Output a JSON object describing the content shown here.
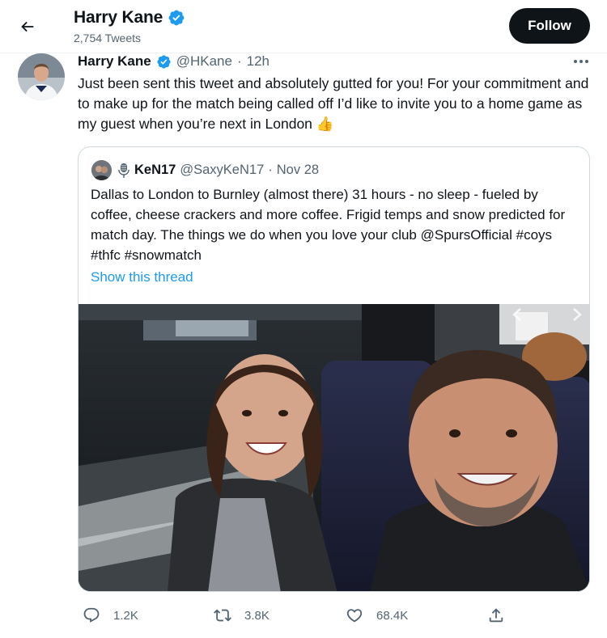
{
  "header": {
    "name": "Harry Kane",
    "tweet_count": "2,754 Tweets",
    "follow_label": "Follow",
    "verified_icon": "verified-badge-icon",
    "back_icon": "arrow-left-icon"
  },
  "tweet": {
    "author": "Harry Kane",
    "handle": "@HKane",
    "separator": "·",
    "time": "12h",
    "text": "Just been sent this tweet and absolutely gutted for you! For your commitment and to make up for the match being called off I’d like to invite you to a home game as my guest when you’re next in London 👍",
    "more_icon": "more-horizontal-icon"
  },
  "quote": {
    "author": "KeN17",
    "handle": "@SaxyKeN17",
    "separator": "·",
    "time": "Nov 28",
    "text": "Dallas to London to Burnley (almost there) 31 hours - no sleep - fueled by coffee, cheese crackers and more coffee.  Frigid temps and snow predicted for match day. The things we do when you love your club @SpursOfficial #coys #thfc #snowmatch",
    "show_thread": "Show this thread",
    "name_icon": "microphone-icon"
  },
  "actions": {
    "reply": "1.2K",
    "retweet": "3.8K",
    "like": "68.4K",
    "reply_icon": "reply-icon",
    "retweet_icon": "retweet-icon",
    "like_icon": "heart-icon",
    "share_icon": "share-icon"
  },
  "colors": {
    "accent": "#1d9bf0",
    "text": "#0f1419",
    "secondary": "#536471",
    "border": "#cfd9de",
    "follow_bg": "#0f1419"
  }
}
